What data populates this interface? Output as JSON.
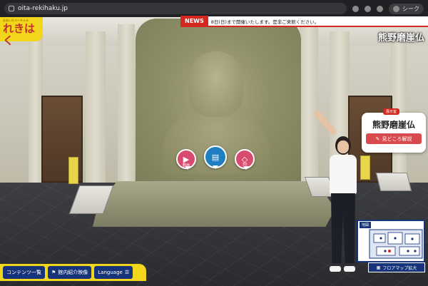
{
  "browser": {
    "url": "oita-rekihaku.jp",
    "profile_label": "シーク"
  },
  "site": {
    "logo_small": "おおいたバーチャル",
    "logo_big": "れきはく"
  },
  "news": {
    "tag": "NEWS",
    "text": "8日(日)まで開催いたします。是非ご来館ください。"
  },
  "scene": {
    "title": "熊野磨崖仏",
    "hotspots": [
      {
        "caption": "動画",
        "color": "#d84a6e"
      },
      {
        "caption": "",
        "color": "#1f7fc0"
      },
      {
        "caption": "3D",
        "color": "#d84a6e"
      }
    ]
  },
  "exhibit_card": {
    "tag": "展示室",
    "name": "熊野磨崖仏",
    "button_label": "見どころ解説"
  },
  "map": {
    "label": "地図",
    "expand_label": "フロアマップ拡大"
  },
  "bottom_nav": {
    "items": [
      {
        "label": "コンテンツ一覧"
      },
      {
        "label": "館内紹介映像"
      },
      {
        "label": "Language"
      }
    ]
  },
  "colors": {
    "brand_yellow": "#f2d61b",
    "brand_navy": "#17347a",
    "news_red": "#d3271f"
  }
}
